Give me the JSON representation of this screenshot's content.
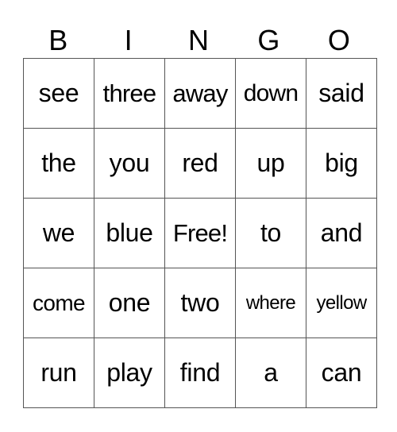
{
  "header": {
    "letters": [
      "B",
      "I",
      "N",
      "G",
      "O"
    ]
  },
  "card": {
    "rows": [
      [
        "see",
        "three",
        "away",
        "down",
        "said"
      ],
      [
        "the",
        "you",
        "red",
        "up",
        "big"
      ],
      [
        "we",
        "blue",
        "Free!",
        "to",
        "and"
      ],
      [
        "come",
        "one",
        "two",
        "where",
        "yellow"
      ],
      [
        "run",
        "play",
        "find",
        "a",
        "can"
      ]
    ]
  }
}
